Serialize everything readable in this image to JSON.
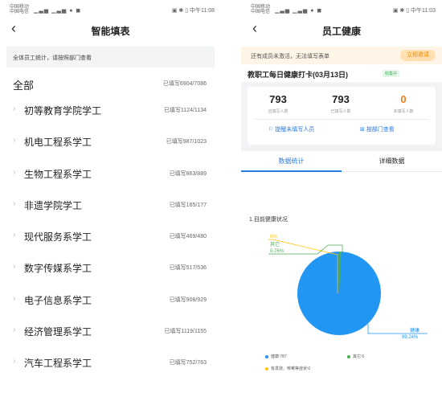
{
  "left": {
    "status": {
      "carrier": "中国移动",
      "carrier2": "中国电信",
      "right": "中午11:08"
    },
    "title": "智能填表",
    "notice": "全体员工统计，请按照部门查看",
    "all": {
      "name": "全部",
      "stat": "已填写6904/7086"
    },
    "departments": [
      {
        "name": "初等教育学院学工",
        "stat": "已填写1124/1134"
      },
      {
        "name": "机电工程系学工",
        "stat": "已填写987/1023"
      },
      {
        "name": "生物工程系学工",
        "stat": "已填写863/889"
      },
      {
        "name": "非遗学院学工",
        "stat": "已填写165/177"
      },
      {
        "name": "现代服务系学工",
        "stat": "已填写469/480"
      },
      {
        "name": "数字传媒系学工",
        "stat": "已填写517/536"
      },
      {
        "name": "电子信息系学工",
        "stat": "已填写908/929"
      },
      {
        "name": "经济管理系学工",
        "stat": "已填写1119/1155"
      },
      {
        "name": "汽车工程系学工",
        "stat": "已填写752/763"
      }
    ]
  },
  "right": {
    "status": {
      "carrier": "中国移动",
      "carrier2": "中国电信",
      "right": "中午11:03"
    },
    "title": "员工健康",
    "warning": "还有成员未激活，无法填写表单",
    "invite_button": "立即邀请",
    "card_title": "教职工每日健康打卡(03月13日)",
    "badge": "收集中",
    "summary": [
      {
        "value": "793",
        "label": "应填写人数"
      },
      {
        "value": "793",
        "label": "已填写人数"
      },
      {
        "value": "0",
        "label": "未填写人数"
      }
    ],
    "remind_button": "提醒未填写人员",
    "dept_button": "按部门查看",
    "tabs": [
      "数据统计",
      "详细数据"
    ],
    "section_title": "1.目前健康状况",
    "colors": {
      "healthy": "#2196f3",
      "other": "#4caf50",
      "symptom": "#ffc107",
      "accent": "#2a7be0",
      "orange": "#f37b1d"
    }
  },
  "chart_data": {
    "type": "pie",
    "slices": [
      {
        "name": "健康",
        "value": 787,
        "percent_label": "99.24%"
      },
      {
        "name": "其它",
        "value": 6,
        "percent_label": "0.76%"
      },
      {
        "name": "有发烧、咳嗽等症状",
        "value": 0,
        "percent_label": "0%"
      }
    ],
    "legend": [
      "健康:787",
      "其它:6",
      "有发烧、咳嗽等症状:0"
    ],
    "labels": {
      "zero": "0%",
      "other_name": "其它",
      "other_pct": "0.76%",
      "healthy_name": "健康",
      "healthy_pct": "99.24%"
    }
  }
}
